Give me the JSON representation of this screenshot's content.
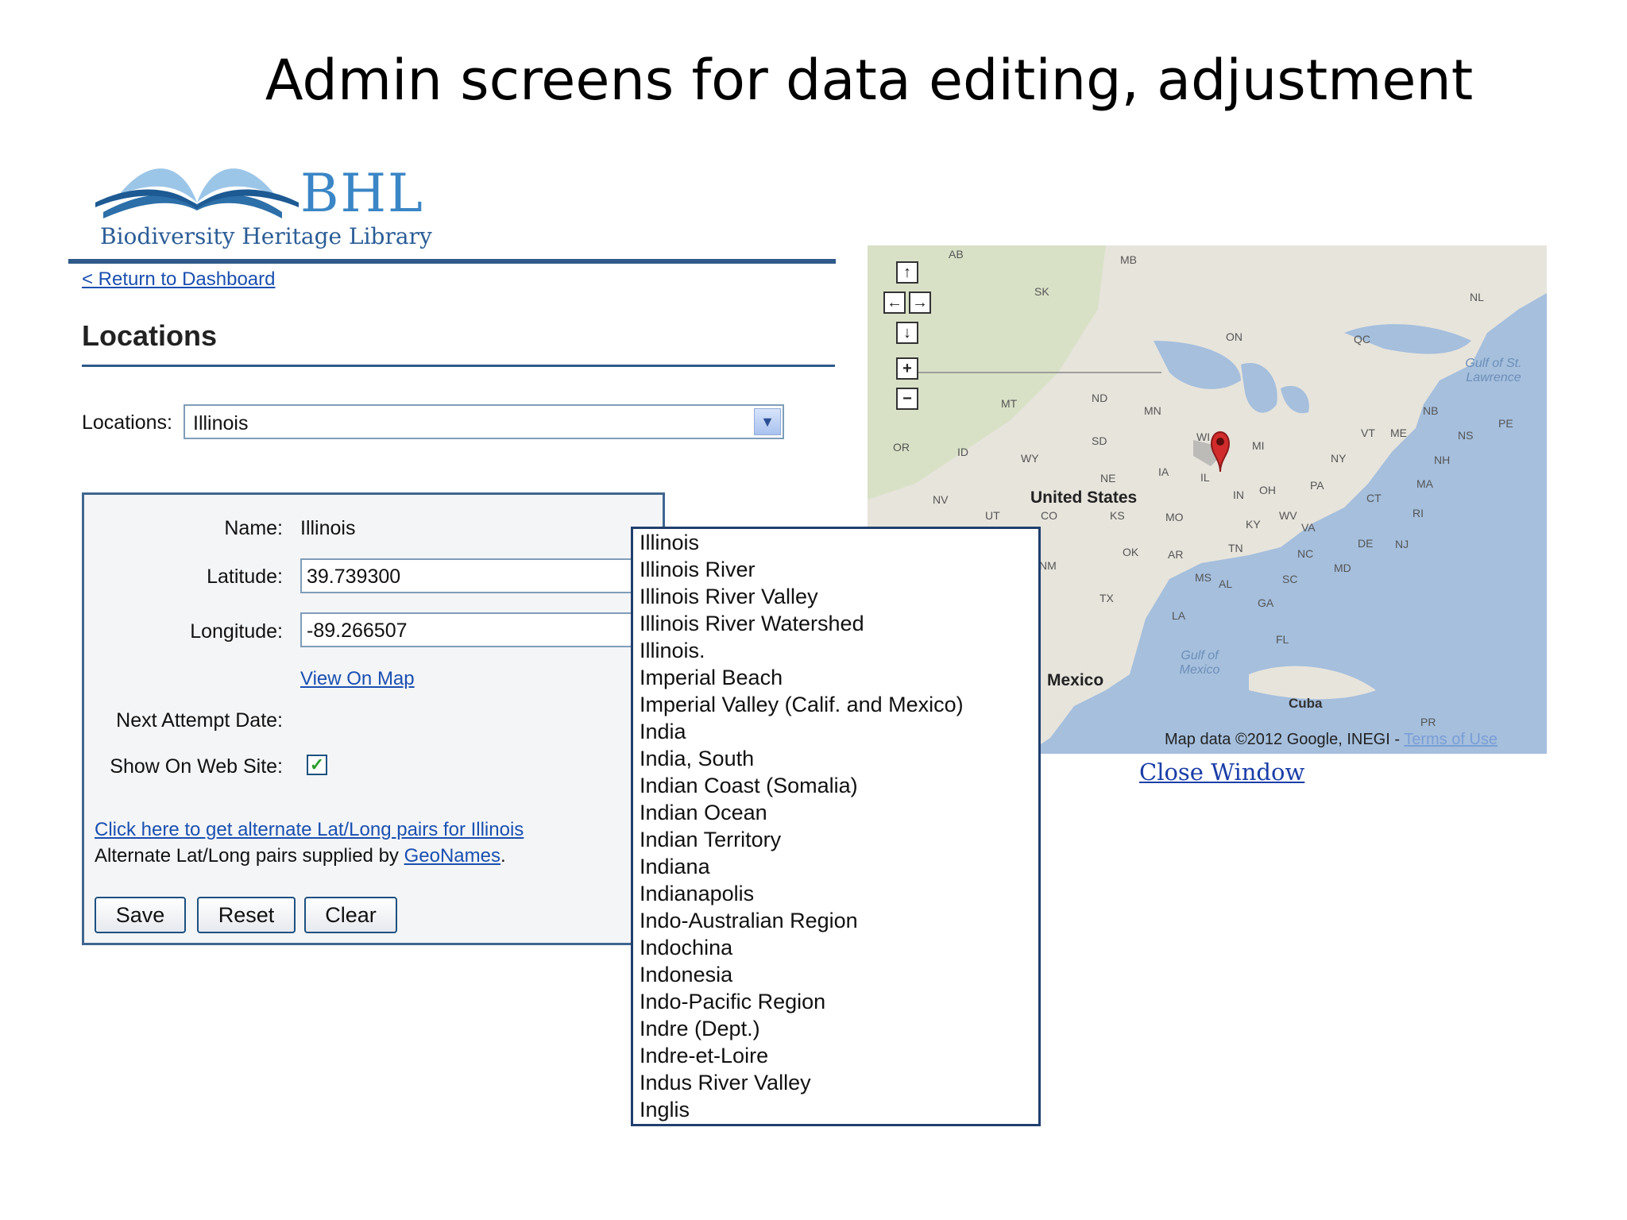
{
  "slide": {
    "title": "Admin screens for data editing, adjustment"
  },
  "logo": {
    "letters": "BHL",
    "subtitle": "Biodiversity Heritage Library"
  },
  "nav": {
    "return_link": "< Return to Dashboard"
  },
  "page": {
    "title": "Locations"
  },
  "locations_select": {
    "label": "Locations:",
    "value": "Illinois"
  },
  "form": {
    "name_label": "Name:",
    "name_value": "Illinois",
    "latitude_label": "Latitude:",
    "latitude_value": "39.739300",
    "longitude_label": "Longitude:",
    "longitude_value": "-89.266507",
    "view_on_map": "View On Map",
    "next_attempt_label": "Next Attempt Date:",
    "show_on_site_label": "Show On Web Site:",
    "show_on_site_checked": true,
    "alt_link": "Click here to get alternate Lat/Long pairs for Illinois",
    "alt_text": "Alternate Lat/Long pairs supplied by",
    "geonames": "GeoNames",
    "period": ".",
    "buttons": {
      "save": "Save",
      "reset": "Reset",
      "clear": "Clear"
    }
  },
  "dropdown": {
    "options": [
      "Illinois",
      "Illinois River",
      "Illinois River Valley",
      "Illinois River Watershed",
      "Illinois.",
      "Imperial Beach",
      "Imperial Valley (Calif. and Mexico)",
      "India",
      "India, South",
      "Indian Coast (Somalia)",
      "Indian Ocean",
      "Indian Territory",
      "Indiana",
      "Indianapolis",
      "Indo-Australian Region",
      "Indochina",
      "Indonesia",
      "Indo-Pacific Region",
      "Indre (Dept.)",
      "Indre-et-Loire",
      "Indus River Valley",
      "Inglis"
    ]
  },
  "map": {
    "labels": [
      "AB",
      "MB",
      "SK",
      "NL",
      "ON",
      "QC",
      "MT",
      "ND",
      "MN",
      "NB",
      "PE",
      "NS",
      "OR",
      "ID",
      "WY",
      "SD",
      "WI",
      "MI",
      "VT",
      "ME",
      "NH",
      "NY",
      "MA",
      "NV",
      "NE",
      "IA",
      "IL",
      "IN",
      "OH",
      "PA",
      "CT",
      "RI",
      "UT",
      "CO",
      "KS",
      "MO",
      "KY",
      "WV",
      "VA",
      "DE",
      "NJ",
      "MD",
      "OK",
      "AR",
      "TN",
      "NC",
      "NM",
      "TX",
      "MS",
      "AL",
      "SC",
      "GA",
      "LA",
      "FL",
      "PR"
    ],
    "country_us": "United States",
    "country_mx": "Mexico",
    "cuba": "Cuba",
    "gulf_st_lawrence": "Gulf of St. Lawrence",
    "gulf_mexico": "Gulf of Mexico",
    "attribution": "Map data ©2012 Google, INEGI - ",
    "terms": "Terms of Use",
    "close": "Close Window",
    "controls": {
      "up": "↑",
      "left": "←",
      "right": "→",
      "down": "↓",
      "zoom_in": "+",
      "zoom_out": "−"
    }
  }
}
